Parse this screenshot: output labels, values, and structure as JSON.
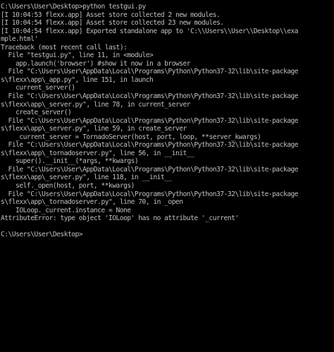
{
  "console": {
    "text_color": "#c0c0c0",
    "background": "#000000",
    "lines": [
      "C:\\Users\\User\\Desktop>python testgui.py",
      "[I 10:04:53 flexx.app] Asset store collected 2 new modules.",
      "[I 10:04:54 flexx.app] Asset store collected 23 new modules.",
      "[I 10:04:54 flexx.app] Exported standalone app to 'C:\\\\Users\\\\User\\\\Desktop\\\\exa",
      "mple.html'",
      "Traceback (most recent call last):",
      "  File \"testgui.py\", line 11, in <module>",
      "    app.launch('browser') #show it now in a browser",
      "  File \"C:\\Users\\User\\AppData\\Local\\Programs\\Python\\Python37-32\\lib\\site-package",
      "s\\flexx\\app\\_app.py\", line 151, in launch",
      "    current_server()",
      "  File \"C:\\Users\\User\\AppData\\Local\\Programs\\Python\\Python37-32\\lib\\site-package",
      "s\\flexx\\app\\_server.py\", line 78, in current_server",
      "    create_server()",
      "  File \"C:\\Users\\User\\AppData\\Local\\Programs\\Python\\Python37-32\\lib\\site-package",
      "s\\flexx\\app\\_server.py\", line 59, in create_server",
      "    _current_server = TornadoServer(host, port, loop, **server_kwargs)",
      "  File \"C:\\Users\\User\\AppData\\Local\\Programs\\Python\\Python37-32\\lib\\site-package",
      "s\\flexx\\app\\_tornadoserver.py\", line 56, in __init__",
      "    super().__init__(*args, **kwargs)",
      "  File \"C:\\Users\\User\\AppData\\Local\\Programs\\Python\\Python37-32\\lib\\site-package",
      "s\\flexx\\app\\_server.py\", line 118, in __init__",
      "    self._open(host, port, **kwargs)",
      "  File \"C:\\Users\\User\\AppData\\Local\\Programs\\Python\\Python37-32\\lib\\site-package",
      "s\\flexx\\app\\_tornadoserver.py\", line 70, in _open",
      "    IOLoop._current.instance = None",
      "AttributeError: type object 'IOLoop' has no attribute '_current'",
      "",
      "C:\\Users\\User\\Desktop>"
    ]
  }
}
